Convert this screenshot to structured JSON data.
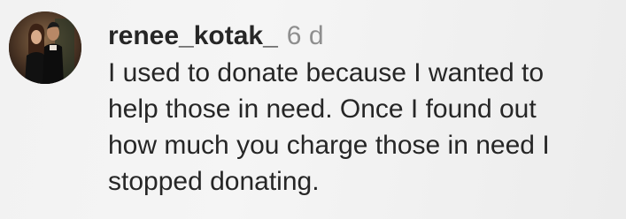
{
  "comment": {
    "username": "renee_kotak_",
    "time": "6 d",
    "lines": [
      "I used to donate because I wanted to",
      "help those in need. Once I found out",
      "how much you charge those in need I",
      "stopped donating."
    ]
  }
}
